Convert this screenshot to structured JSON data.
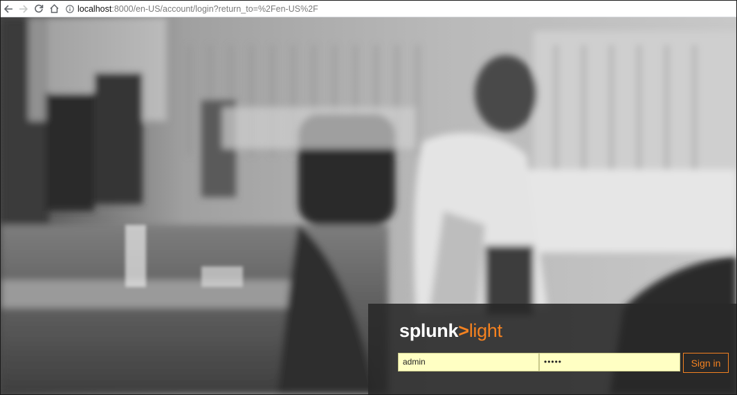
{
  "browser": {
    "url_host": "localhost",
    "url_path": ":8000/en-US/account/login?return_to=%2Fen-US%2F",
    "icons": [
      "back-icon",
      "forward-icon",
      "reload-icon",
      "home-icon",
      "info-icon"
    ]
  },
  "login": {
    "brand_primary": "splunk",
    "brand_chevron": ">",
    "brand_secondary": "light",
    "username_value": "admin",
    "password_masked": "•••••",
    "signin_label": "Sign in"
  },
  "colors": {
    "accent": "#f58220",
    "panel": "#282828",
    "field_bg": "#ffffc3"
  }
}
